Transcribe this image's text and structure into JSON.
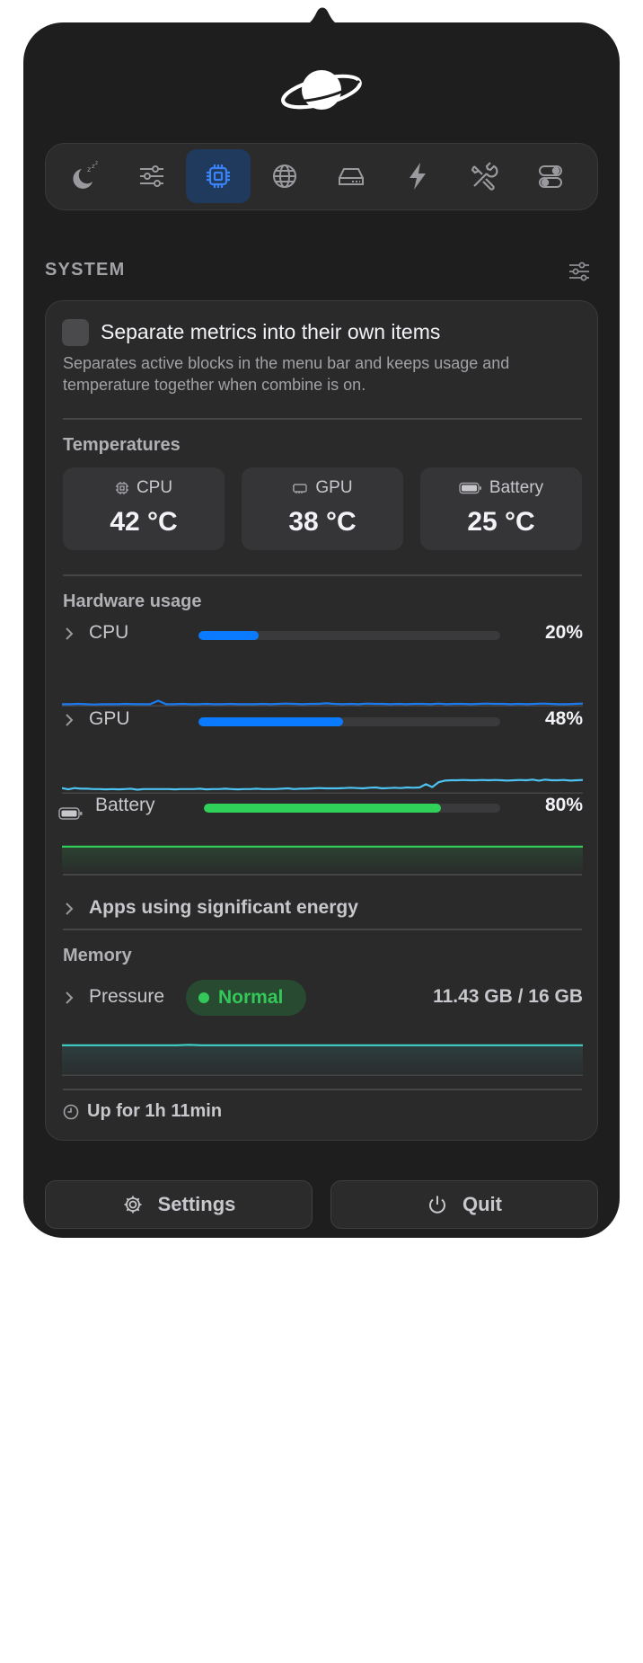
{
  "tabs": [
    {
      "icon": "sleep-icon",
      "active": false
    },
    {
      "icon": "sliders-icon",
      "active": false
    },
    {
      "icon": "cpu-chip-icon",
      "active": true
    },
    {
      "icon": "globe-icon",
      "active": false
    },
    {
      "icon": "drive-icon",
      "active": false
    },
    {
      "icon": "bolt-icon",
      "active": false
    },
    {
      "icon": "tools-icon",
      "active": false
    },
    {
      "icon": "toggles-icon",
      "active": false
    }
  ],
  "section": {
    "title": "SYSTEM"
  },
  "separate_metrics": {
    "label": "Separate metrics into their own items",
    "description": "Separates active blocks in the menu bar and keeps usage and temperature together when combine is on.",
    "checked": false
  },
  "temperatures": {
    "title": "Temperatures",
    "items": [
      {
        "label": "CPU",
        "value": "42 °C",
        "icon": "cpu-chip-icon"
      },
      {
        "label": "GPU",
        "value": "38 °C",
        "icon": "gpu-card-icon"
      },
      {
        "label": "Battery",
        "value": "25 °C",
        "icon": "battery-icon"
      }
    ]
  },
  "hardware_usage": {
    "title": "Hardware usage",
    "cpu": {
      "label": "CPU",
      "percent_text": "20%",
      "percent": 20,
      "color": "#0a7aff"
    },
    "gpu": {
      "label": "GPU",
      "percent_text": "48%",
      "percent": 48,
      "color": "#0a7aff"
    },
    "battery": {
      "label": "Battery",
      "percent_text": "80%",
      "percent": 80,
      "color": "#30d158"
    },
    "cpu_history": [
      2,
      2,
      3,
      2,
      1,
      2,
      2,
      2,
      3,
      2,
      2,
      2,
      14,
      2,
      2,
      3,
      2,
      2,
      3,
      2,
      2,
      3,
      2,
      2,
      2,
      3,
      2,
      3,
      4,
      3,
      2,
      3,
      3,
      5,
      3,
      2,
      3,
      2,
      4,
      3,
      3,
      2,
      3,
      2,
      3,
      3,
      2,
      4,
      2,
      3,
      3,
      2,
      3,
      4,
      3,
      3,
      2,
      3,
      2,
      3,
      4,
      3,
      2,
      2,
      3,
      4
    ],
    "gpu_history": [
      12,
      8,
      12,
      10,
      10,
      9,
      9,
      8,
      9,
      8,
      9,
      10,
      7,
      9,
      9,
      9,
      9,
      9,
      8,
      9,
      9,
      9,
      10,
      8,
      9,
      9,
      10,
      9,
      8,
      9,
      9,
      10,
      9,
      9,
      9,
      10,
      11,
      9,
      10,
      10,
      11,
      12,
      11,
      11,
      11,
      12,
      13,
      12,
      11,
      13,
      14,
      11,
      12,
      13,
      12,
      14,
      13,
      14,
      24,
      15,
      30,
      35,
      36,
      36,
      37,
      36,
      36,
      37,
      36,
      37,
      36,
      35,
      36,
      37,
      36,
      38,
      35,
      38,
      36,
      36,
      37,
      35,
      36,
      37
    ],
    "battery_history": [
      82,
      82,
      82,
      82,
      82,
      82,
      82,
      82,
      82,
      82,
      82,
      82,
      82,
      82,
      82,
      82,
      82,
      82,
      82,
      82,
      82,
      82
    ]
  },
  "apps_energy": {
    "label": "Apps using significant energy"
  },
  "memory": {
    "title": "Memory",
    "pressure_label": "Pressure",
    "status": "Normal",
    "status_color": "#34c759",
    "usage": "11.43 GB / 16 GB",
    "history": [
      70,
      70,
      70,
      70,
      70,
      70,
      70,
      70,
      70,
      70,
      71,
      70,
      70,
      70,
      70,
      70,
      70,
      70,
      70,
      70,
      70,
      70,
      70,
      70,
      70,
      70,
      70,
      70,
      70,
      70,
      70,
      70,
      70,
      70,
      70,
      70,
      70,
      70,
      70,
      70,
      70,
      70
    ]
  },
  "uptime": {
    "text": "Up for 1h 11min"
  },
  "footer": {
    "settings_label": "Settings",
    "quit_label": "Quit"
  }
}
